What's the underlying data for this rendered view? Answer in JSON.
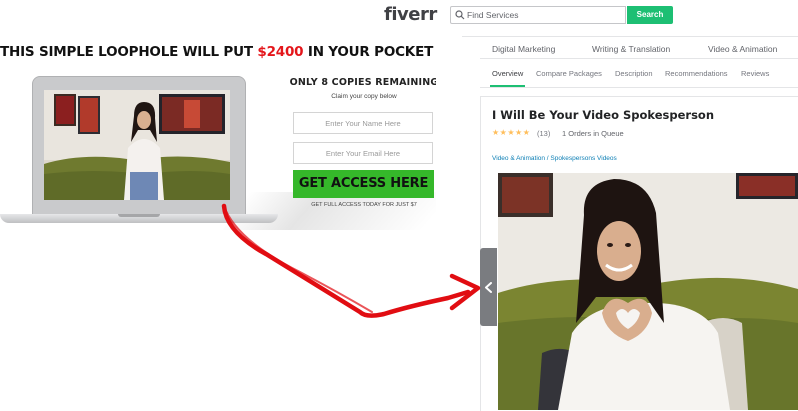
{
  "landing": {
    "headline_prefix": "THIS SIMPLE LOOPHOLE WILL PUT ",
    "headline_price": "$2400",
    "headline_suffix": " IN YOUR POCKET TODAY!",
    "offer_title": "ONLY 8 COPIES REMAINING",
    "offer_subtitle": "Claim your copy below",
    "name_placeholder": "Enter Your Name Here",
    "email_placeholder": "Enter Your Email Here",
    "cta_label": "GET ACCESS HERE",
    "cta_note": "GET FULL ACCESS TODAY FOR JUST $7",
    "accent_color": "#e4161b",
    "cta_color": "#35b82a"
  },
  "marketplace": {
    "logo": "fiverr",
    "search_placeholder": "Find Services",
    "search_button": "Search",
    "categories": [
      "Digital Marketing",
      "Writing & Translation",
      "Video & Animation"
    ],
    "tabs": [
      "Overview",
      "Compare Packages",
      "Description",
      "Recommendations",
      "Reviews"
    ],
    "active_tab": "Overview",
    "gig_title": "I Will Be Your Video Spokesperson",
    "rating_stars": "★★★★★",
    "rating_value": 5,
    "rating_count": "(13)",
    "orders_in_queue": "1 Orders in Queue",
    "breadcrumbs": "Video & Animation / Spokespersons Videos",
    "brand_color": "#1dbf73",
    "star_color": "#ffbe5b",
    "link_color": "#0d7fb5"
  },
  "icons": {
    "search": "search-icon",
    "collapse": "chevron-left-icon",
    "arrow": "red-curved-arrow"
  }
}
